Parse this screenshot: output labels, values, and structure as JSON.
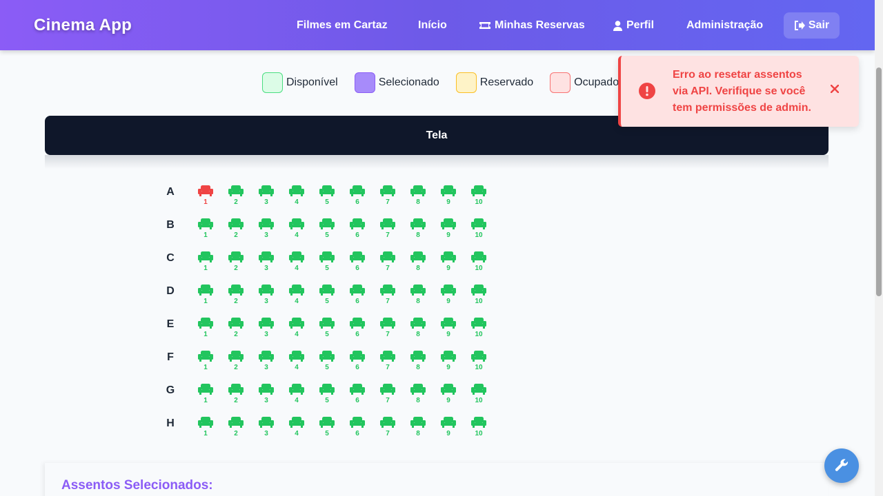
{
  "navbar": {
    "brand": "Cinema App",
    "links": [
      "Filmes em Cartaz",
      "Início",
      "Minhas Reservas",
      "Perfil",
      "Administração"
    ],
    "logout_label": "Sair"
  },
  "legend": {
    "available": "Disponível",
    "selected": "Selecionado",
    "reserved": "Reservado",
    "occupied": "Ocupado"
  },
  "colors": {
    "available": "#22c55e",
    "occupied": "#ef4444",
    "accent": "#8b5cf6",
    "screen": "#0f172a"
  },
  "screen_label": "Tela",
  "seat_map": {
    "rows": [
      "A",
      "B",
      "C",
      "D",
      "E",
      "F",
      "G",
      "H"
    ],
    "seats_per_row": 10,
    "occupied": [
      "A1"
    ]
  },
  "toast": {
    "message": "Erro ao resetar assentos via API. Verifique se você tem permissões de admin.",
    "icon": "exclamation-circle-icon"
  },
  "selected_section": {
    "title": "Assentos Selecionados:"
  },
  "fab_icon": "wrench-icon"
}
